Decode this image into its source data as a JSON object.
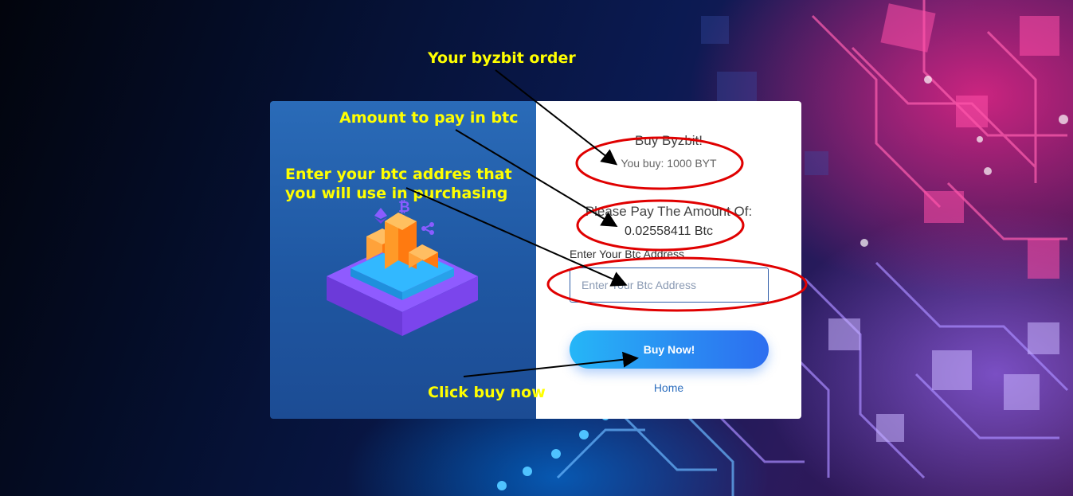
{
  "card": {
    "title": "Buy Byzbit!",
    "you_buy": "You buy: 1000 BYT",
    "pay_label": "Please Pay The Amount Of:",
    "pay_amount": "0.02558411 Btc",
    "address_label": "Enter Your Btc Address",
    "address_placeholder": "Enter Your Btc Address",
    "address_value": "",
    "buy_button": "Buy Now!",
    "home_link": "Home"
  },
  "annotations": {
    "order": "Your byzbit order",
    "amount": "Amount to pay in btc",
    "address_line1": "Enter your btc addres that",
    "address_line2": "you will use in purchasing",
    "click": "Click buy now"
  },
  "colors": {
    "annotation_text": "#ffff00",
    "circle": "#e00000",
    "button": "#2a8cf2",
    "left_panel": "#1f57a2"
  },
  "icons": {
    "illustration": "crypto-blocks-illustration",
    "ethereum": "ethereum-icon",
    "bitcoin": "bitcoin-icon",
    "ripple": "ripple-icon"
  }
}
